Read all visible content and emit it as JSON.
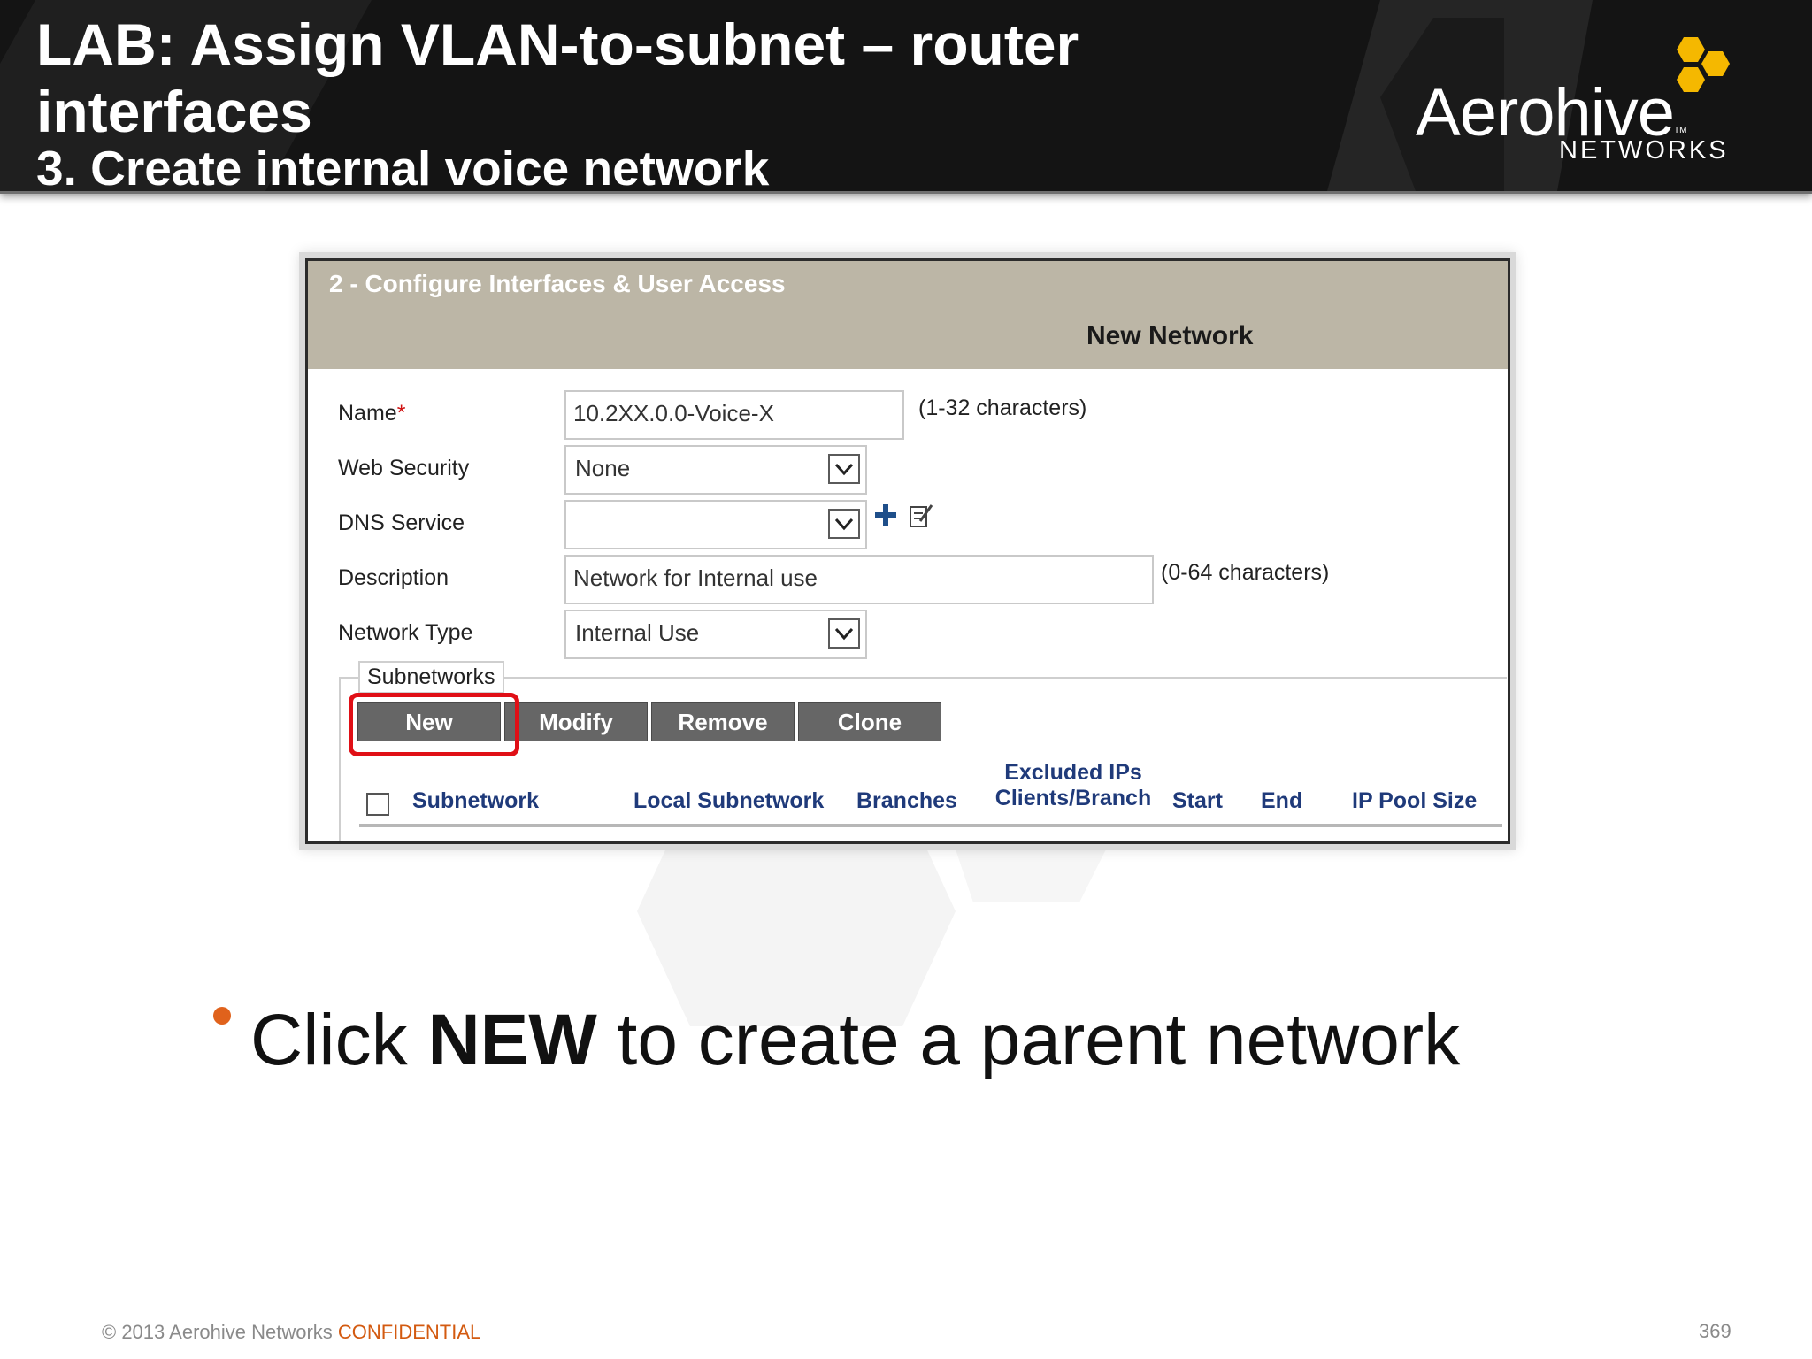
{
  "slide": {
    "title_line1": "LAB: Assign VLAN-to-subnet – router",
    "title_line2": "interfaces",
    "subtitle": "3. Create internal voice network",
    "logo_word": "Aerohive",
    "logo_tm": "TM",
    "logo_sub": "NETWORKS",
    "bullet": {
      "pre": "Click ",
      "bold": "NEW",
      "post": " to create a parent network"
    },
    "footer": {
      "copyright": "© 2013 Aerohive Networks ",
      "confidential": "CONFIDENTIAL",
      "page_number": "369"
    }
  },
  "panel": {
    "step_title": "2 - Configure Interfaces & User Access",
    "title": "New Network",
    "fields": {
      "name": {
        "label": "Name",
        "required_mark": "*",
        "value": "10.2XX.0.0-Voice-X",
        "hint": "(1-32 characters)"
      },
      "web_security": {
        "label": "Web Security",
        "value": "None"
      },
      "dns_service": {
        "label": "DNS Service",
        "value": ""
      },
      "description": {
        "label": "Description",
        "value": "Network for Internal use",
        "hint": "(0-64 characters)"
      },
      "network_type": {
        "label": "Network Type",
        "value": "Internal Use"
      }
    },
    "subnetworks": {
      "legend": "Subnetworks",
      "buttons": {
        "new": "New",
        "modify": "Modify",
        "remove": "Remove",
        "clone": "Clone"
      },
      "columns": {
        "subnetwork": "Subnetwork",
        "local_subnetwork": "Local Subnetwork",
        "branches": "Branches",
        "excluded_ips_1": "Excluded IPs",
        "excluded_ips_2": "Clients/Branch",
        "start": "Start",
        "end": "End",
        "ip_pool_size": "IP Pool Size"
      }
    }
  },
  "colors": {
    "accent": "#e0621c",
    "highlight": "#e00f16",
    "header_bg": "#141414",
    "logo_hex": "#f5b800"
  }
}
